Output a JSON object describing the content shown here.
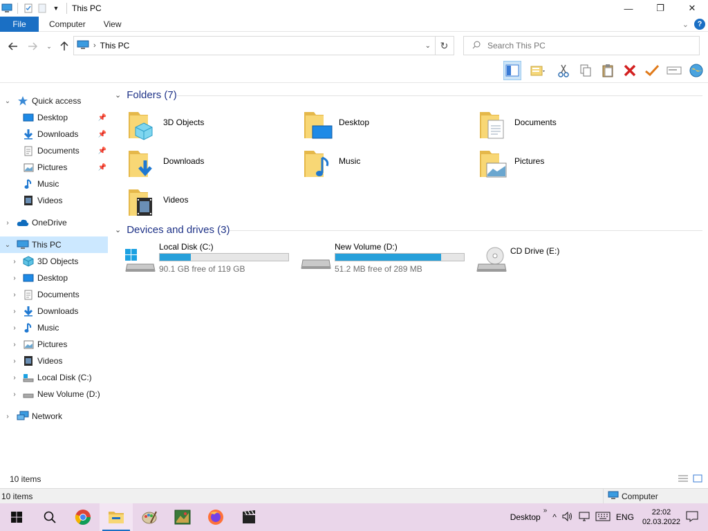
{
  "window": {
    "title": "This PC",
    "controls": {
      "minimize": "—",
      "maximize": "❐",
      "close": "✕"
    }
  },
  "ribbon": {
    "tabs": [
      {
        "label": "File"
      },
      {
        "label": "Computer"
      },
      {
        "label": "View"
      }
    ]
  },
  "address": {
    "crumb": "This PC",
    "search_placeholder": "Search This PC"
  },
  "nav": {
    "quick_access": {
      "label": "Quick access",
      "items": [
        {
          "label": "Desktop",
          "pinned": true
        },
        {
          "label": "Downloads",
          "pinned": true
        },
        {
          "label": "Documents",
          "pinned": true
        },
        {
          "label": "Pictures",
          "pinned": true
        },
        {
          "label": "Music",
          "pinned": false
        },
        {
          "label": "Videos",
          "pinned": false
        }
      ]
    },
    "onedrive": "OneDrive",
    "this_pc": {
      "label": "This PC",
      "items": [
        {
          "label": "3D Objects"
        },
        {
          "label": "Desktop"
        },
        {
          "label": "Documents"
        },
        {
          "label": "Downloads"
        },
        {
          "label": "Music"
        },
        {
          "label": "Pictures"
        },
        {
          "label": "Videos"
        },
        {
          "label": "Local Disk (C:)"
        },
        {
          "label": "New Volume (D:)"
        }
      ]
    },
    "network": "Network"
  },
  "content": {
    "folders_header": "Folders (7)",
    "folders": [
      {
        "name": "3D Objects",
        "icon": "3d-objects-icon"
      },
      {
        "name": "Desktop",
        "icon": "desktop-icon"
      },
      {
        "name": "Documents",
        "icon": "documents-icon"
      },
      {
        "name": "Downloads",
        "icon": "downloads-icon"
      },
      {
        "name": "Music",
        "icon": "music-icon"
      },
      {
        "name": "Pictures",
        "icon": "pictures-icon"
      },
      {
        "name": "Videos",
        "icon": "videos-icon"
      }
    ],
    "drives_header": "Devices and drives (3)",
    "drives": [
      {
        "name": "Local Disk (C:)",
        "free": "90.1 GB free of 119 GB",
        "used_fraction": 0.243,
        "has_bar": true
      },
      {
        "name": "New Volume (D:)",
        "free": "51.2 MB free of 289 MB",
        "used_fraction": 0.823,
        "has_bar": true
      },
      {
        "name": "CD Drive (E:)",
        "free": "",
        "used_fraction": 0,
        "has_bar": false
      }
    ]
  },
  "status": {
    "item_count": "10 items",
    "bottom_count": "10 items",
    "bottom_location": "Computer"
  },
  "taskbar": {
    "desktop_label": "Desktop",
    "chevrons": "»",
    "language": "ENG",
    "time": "22:02",
    "date": "02.03.2022"
  },
  "colors": {
    "accent": "#1a6fc4",
    "progress": "#26a0da",
    "selection": "#cce8ff",
    "group_header": "#1e3287",
    "taskbar": "#ead6ea"
  }
}
